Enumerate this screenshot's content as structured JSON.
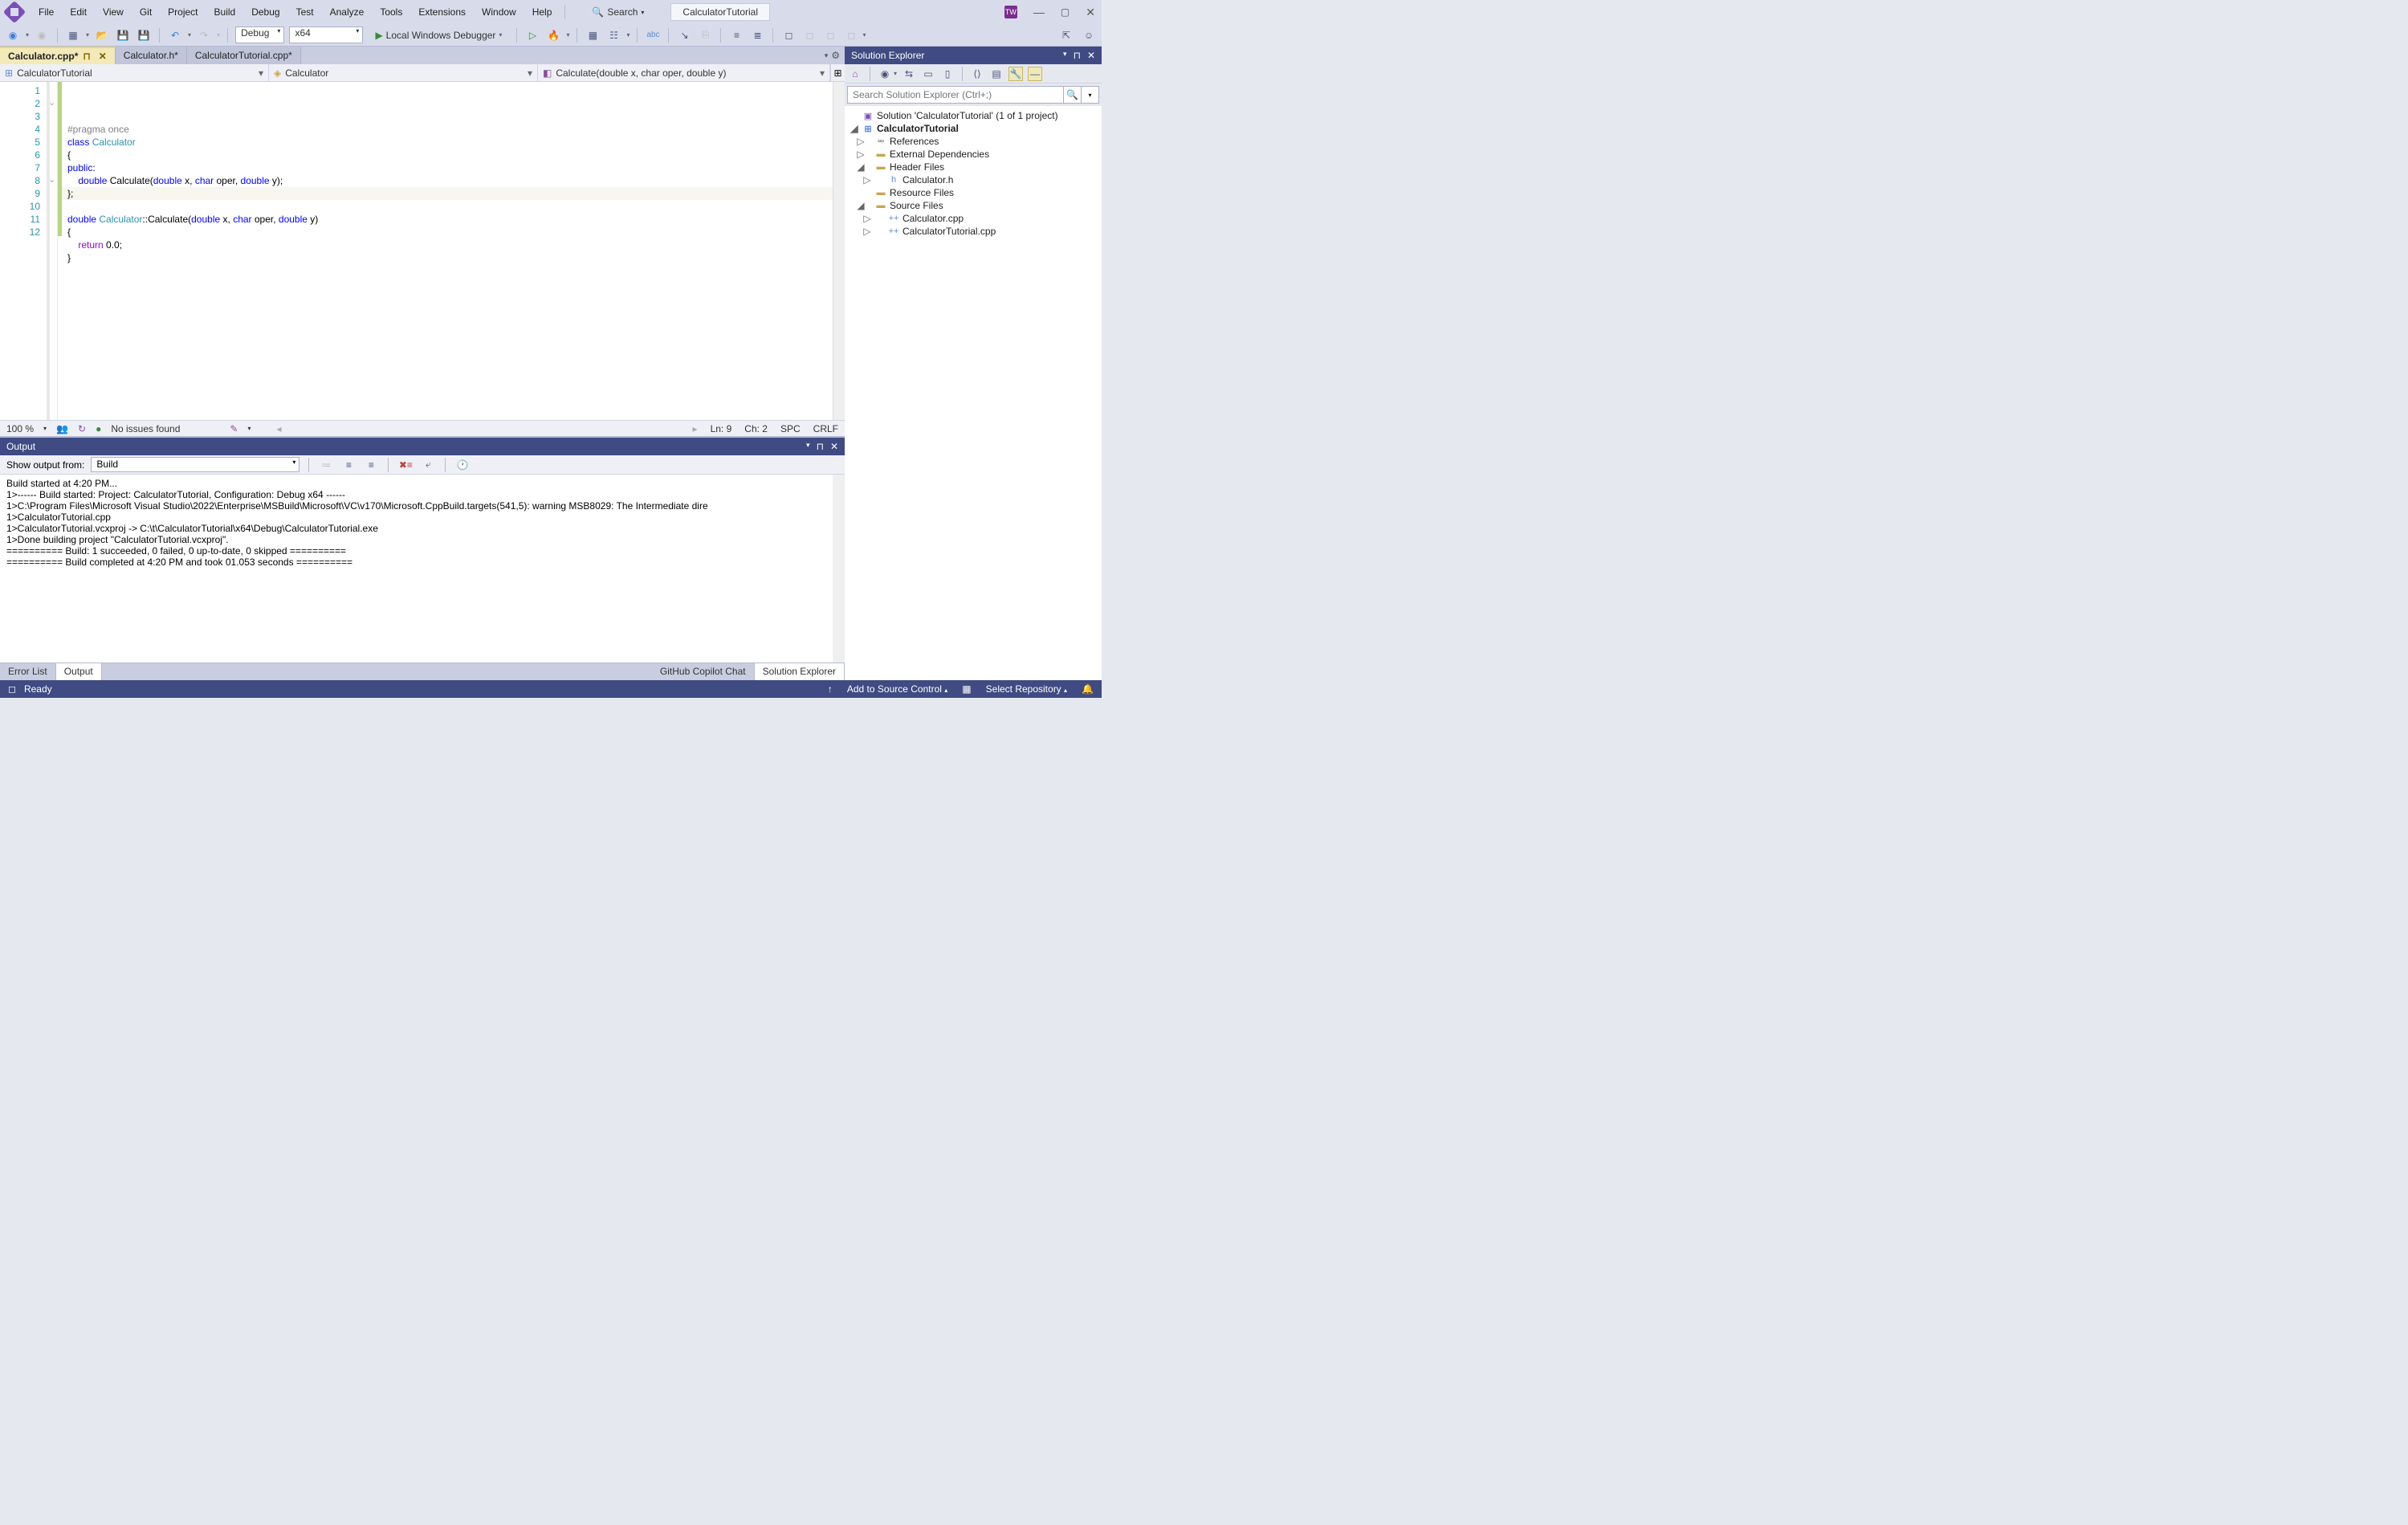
{
  "title_document": "CalculatorTutorial",
  "menu": [
    "File",
    "Edit",
    "View",
    "Git",
    "Project",
    "Build",
    "Debug",
    "Test",
    "Analyze",
    "Tools",
    "Extensions",
    "Window",
    "Help"
  ],
  "search_label": "Search",
  "toolbar": {
    "config": "Debug",
    "platform": "x64",
    "debugger_label": "Local Windows Debugger"
  },
  "doc_tabs": [
    {
      "label": "Calculator.cpp*",
      "active": true,
      "pinned": true
    },
    {
      "label": "Calculator.h*",
      "active": false
    },
    {
      "label": "CalculatorTutorial.cpp*",
      "active": false
    }
  ],
  "nav": {
    "scope": "CalculatorTutorial",
    "class": "Calculator",
    "member": "Calculate(double x, char oper, double y)"
  },
  "code_lines": [
    {
      "n": 1,
      "html": "<span class='pre'>#pragma</span> <span class='pre'>once</span>"
    },
    {
      "n": 2,
      "html": "<span class='kw'>class</span> <span class='type'>Calculator</span>",
      "fold": "-"
    },
    {
      "n": 3,
      "html": "{"
    },
    {
      "n": 4,
      "html": "<span class='kw'>public</span>:"
    },
    {
      "n": 5,
      "html": "    <span class='kw'>double</span> Calculate(<span class='kw'>double</span> x, <span class='kw'>char</span> oper, <span class='kw'>double</span> y);"
    },
    {
      "n": 6,
      "html": "};"
    },
    {
      "n": 7,
      "html": ""
    },
    {
      "n": 8,
      "html": "<span class='kw'>double</span> <span class='type'>Calculator</span>::Calculate(<span class='kw'>double</span> x, <span class='kw'>char</span> oper, <span class='kw'>double</span> y)",
      "fold": "-"
    },
    {
      "n": 9,
      "html": "{",
      "current": true
    },
    {
      "n": 10,
      "html": "    <span class='ctrl'>return</span> 0.0;"
    },
    {
      "n": 11,
      "html": "}"
    },
    {
      "n": 12,
      "html": ""
    }
  ],
  "editor_status": {
    "zoom": "100 %",
    "issues": "No issues found",
    "ln": "Ln: 9",
    "ch": "Ch: 2",
    "spc": "SPC",
    "eol": "CRLF"
  },
  "output": {
    "title": "Output",
    "show_label": "Show output from:",
    "source": "Build",
    "lines": [
      "Build started at 4:20 PM...",
      "1>------ Build started: Project: CalculatorTutorial, Configuration: Debug x64 ------",
      "1>C:\\Program Files\\Microsoft Visual Studio\\2022\\Enterprise\\MSBuild\\Microsoft\\VC\\v170\\Microsoft.CppBuild.targets(541,5): warning MSB8029: The Intermediate dire",
      "1>CalculatorTutorial.cpp",
      "1>CalculatorTutorial.vcxproj -> C:\\t\\CalculatorTutorial\\x64\\Debug\\CalculatorTutorial.exe",
      "1>Done building project \"CalculatorTutorial.vcxproj\".",
      "========== Build: 1 succeeded, 0 failed, 0 up-to-date, 0 skipped ==========",
      "========== Build completed at 4:20 PM and took 01.053 seconds =========="
    ]
  },
  "bottom_tabs_left": [
    {
      "label": "Error List",
      "active": false
    },
    {
      "label": "Output",
      "active": true
    }
  ],
  "bottom_tabs_right": [
    {
      "label": "GitHub Copilot Chat",
      "active": false
    },
    {
      "label": "Solution Explorer",
      "active": true
    }
  ],
  "statusbar": {
    "ready": "Ready",
    "source_control": "Add to Source Control",
    "repo": "Select Repository"
  },
  "solution_explorer": {
    "title": "Solution Explorer",
    "search_placeholder": "Search Solution Explorer (Ctrl+;)",
    "solution": "Solution 'CalculatorTutorial' (1 of 1 project)",
    "project": "CalculatorTutorial",
    "refs": "References",
    "ext_deps": "External Dependencies",
    "header_files": "Header Files",
    "calc_h": "Calculator.h",
    "res_files": "Resource Files",
    "src_files": "Source Files",
    "calc_cpp": "Calculator.cpp",
    "tut_cpp": "CalculatorTutorial.cpp"
  }
}
